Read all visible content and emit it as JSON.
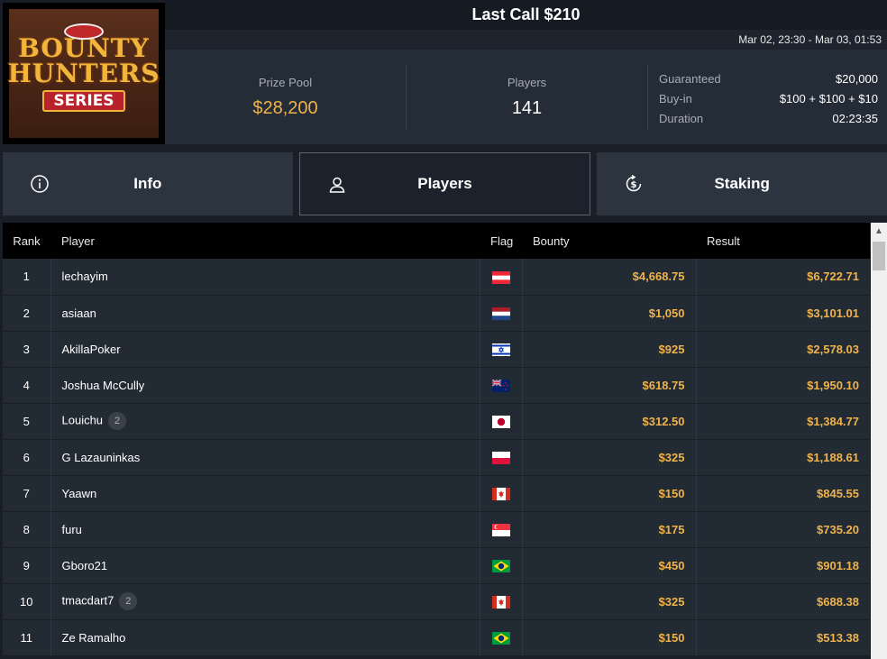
{
  "logo": {
    "line1": "BOUNTY",
    "line2": "HUNTERS",
    "line3": "SERIES"
  },
  "header": {
    "title": "Last Call $210",
    "dates": "Mar 02, 23:30 - Mar 03, 01:53"
  },
  "stats": {
    "prize_pool_label": "Prize Pool",
    "prize_pool_value": "$28,200",
    "players_label": "Players",
    "players_value": "141",
    "guaranteed_label": "Guaranteed",
    "guaranteed_value": "$20,000",
    "buyin_label": "Buy-in",
    "buyin_value": "$100 + $100 + $10",
    "duration_label": "Duration",
    "duration_value": "02:23:35"
  },
  "tabs": [
    {
      "label": "Info",
      "icon": "info-icon"
    },
    {
      "label": "Players",
      "icon": "user-icon"
    },
    {
      "label": "Staking",
      "icon": "dollar-cycle-icon"
    }
  ],
  "active_tab": "Players",
  "table": {
    "headers": {
      "rank": "Rank",
      "player": "Player",
      "flag": "Flag",
      "bounty": "Bounty",
      "result": "Result"
    },
    "rows": [
      {
        "rank": "1",
        "player": "lechayim",
        "badge": "",
        "flag": "austria",
        "bounty": "$4,668.75",
        "result": "$6,722.71"
      },
      {
        "rank": "2",
        "player": "asiaan",
        "badge": "",
        "flag": "netherlands",
        "bounty": "$1,050",
        "result": "$3,101.01"
      },
      {
        "rank": "3",
        "player": "AkillaPoker",
        "badge": "",
        "flag": "israel",
        "bounty": "$925",
        "result": "$2,578.03"
      },
      {
        "rank": "4",
        "player": "Joshua McCully",
        "badge": "",
        "flag": "new-zealand",
        "bounty": "$618.75",
        "result": "$1,950.10"
      },
      {
        "rank": "5",
        "player": "Louichu",
        "badge": "2",
        "flag": "japan",
        "bounty": "$312.50",
        "result": "$1,384.77"
      },
      {
        "rank": "6",
        "player": "G Lazauninkas",
        "badge": "",
        "flag": "poland",
        "bounty": "$325",
        "result": "$1,188.61"
      },
      {
        "rank": "7",
        "player": "Yaawn",
        "badge": "",
        "flag": "canada",
        "bounty": "$150",
        "result": "$845.55"
      },
      {
        "rank": "8",
        "player": "furu",
        "badge": "",
        "flag": "singapore",
        "bounty": "$175",
        "result": "$735.20"
      },
      {
        "rank": "9",
        "player": "Gboro21",
        "badge": "",
        "flag": "brazil",
        "bounty": "$450",
        "result": "$901.18"
      },
      {
        "rank": "10",
        "player": "tmacdart7",
        "badge": "2",
        "flag": "canada",
        "bounty": "$325",
        "result": "$688.38"
      },
      {
        "rank": "11",
        "player": "Ze Ramalho",
        "badge": "",
        "flag": "brazil",
        "bounty": "$150",
        "result": "$513.38"
      }
    ]
  },
  "colors": {
    "gold": "#f0b34a",
    "background": "#1a1f27",
    "row": "#222a34"
  }
}
